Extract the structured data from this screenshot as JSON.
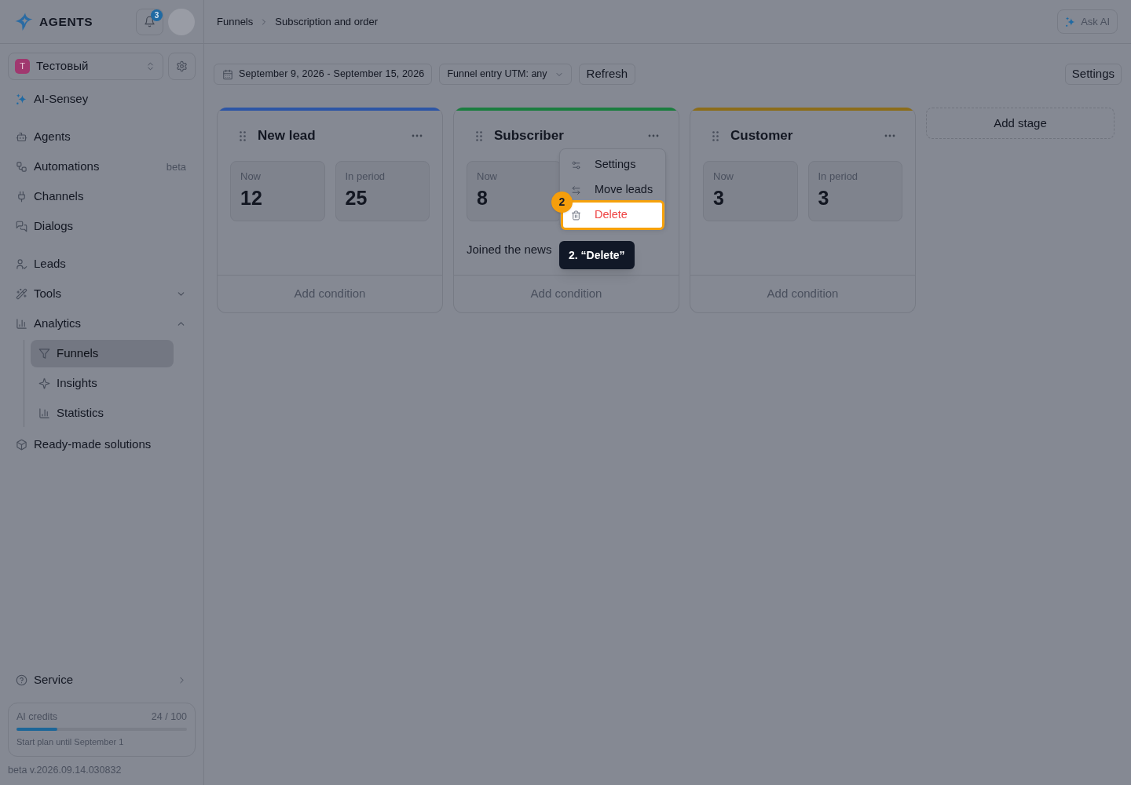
{
  "sidebar": {
    "logo": "AGENTS",
    "notification_count": "3",
    "workspace": {
      "initial": "T",
      "name": "Тестовый"
    },
    "nav_groups": [
      {
        "items": [
          {
            "label": "AI-Sensey",
            "selected": false
          }
        ]
      },
      {
        "items": [
          {
            "label": "Agents",
            "selected": false
          },
          {
            "label": "Automations",
            "badge": "beta",
            "selected": false
          },
          {
            "label": "Channels",
            "selected": false
          },
          {
            "label": "Dialogs",
            "selected": false
          }
        ]
      },
      {
        "items": [
          {
            "label": "Leads",
            "selected": false
          },
          {
            "label": "Tools",
            "expanded": false,
            "selected": false
          },
          {
            "label": "Analytics",
            "expanded": true,
            "selected": false,
            "children": [
              {
                "label": "Funnels",
                "selected": true
              },
              {
                "label": "Insights",
                "selected": false
              },
              {
                "label": "Statistics",
                "selected": false
              }
            ]
          },
          {
            "label": "Ready-made solutions",
            "selected": false
          }
        ]
      }
    ],
    "service": "Service",
    "credits": {
      "label": "AI credits",
      "reading": "24 / 100",
      "level": 0.24,
      "plan": "Start plan until September 1"
    },
    "version": "beta v.2026.09.14.030832"
  },
  "header": {
    "breadcrumbs": [
      "Funnels",
      "Subscription and order"
    ],
    "ask_ai": "Ask AI"
  },
  "toolbar": {
    "date_range": "September 9, 2026 - September 15, 2026",
    "utm_filter": "Funnel entry UTM: any",
    "refresh": "Refresh",
    "settings": "Settings"
  },
  "stages": [
    {
      "title": "New lead",
      "color": "#2d55a5",
      "stats": [
        {
          "label": "Now",
          "value": "12"
        },
        {
          "label": "In period",
          "value": "25"
        }
      ],
      "footer": "Add condition"
    },
    {
      "title": "Subscriber",
      "color": "#1b7d3f",
      "stats": [
        {
          "label": "Now",
          "value": "8"
        }
      ],
      "condition": "Joined the news",
      "footer": "Add condition",
      "menu": {
        "items": [
          {
            "label": "Settings",
            "kind": "normal",
            "highlighted": false
          },
          {
            "label": "Move leads",
            "kind": "normal",
            "highlighted": false
          },
          {
            "label": "Delete",
            "kind": "danger",
            "highlighted": true
          }
        ],
        "tutorial": {
          "step": "2",
          "tooltip": "2. “Delete”"
        }
      }
    },
    {
      "title": "Customer",
      "color": "#8c6d1a",
      "stats": [
        {
          "label": "Now",
          "value": "3"
        },
        {
          "label": "In period",
          "value": "3"
        }
      ],
      "footer": "Add condition"
    }
  ],
  "add_stage": "Add stage"
}
